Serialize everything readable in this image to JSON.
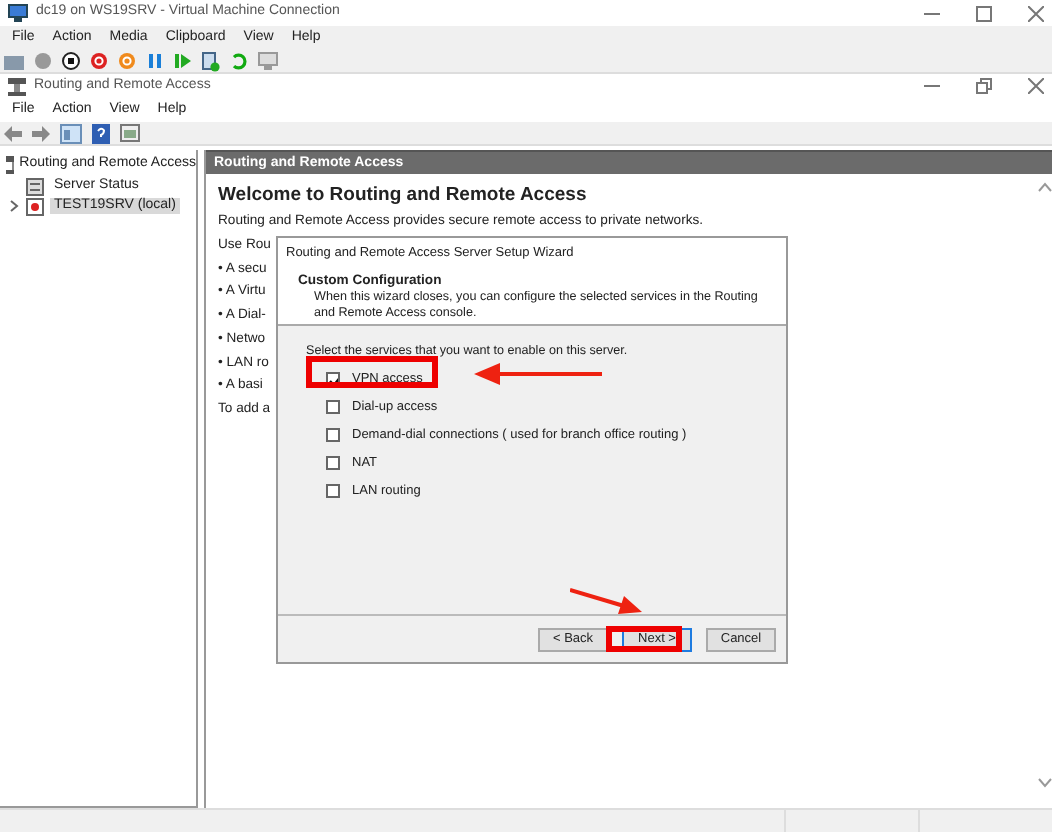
{
  "vm_window": {
    "title": "dc19 on WS19SRV - Virtual Machine Connection",
    "menu": [
      "File",
      "Action",
      "Media",
      "Clipboard",
      "View",
      "Help"
    ]
  },
  "mmc_window": {
    "title": "Routing and Remote Access",
    "menu": [
      "File",
      "Action",
      "View",
      "Help"
    ]
  },
  "tree": [
    {
      "label": "Routing and Remote Access",
      "selected": false,
      "children": [
        {
          "label": "Server Status",
          "selected": false
        },
        {
          "label": "TEST19SRV (local)",
          "selected": true,
          "expanded": false
        }
      ]
    }
  ],
  "pane": {
    "header": "Routing and Remote Access",
    "heading": "Welcome to Routing and Remote Access",
    "intro": "Routing and Remote Access provides secure remote access to private networks.",
    "lines": [
      "Use Rou",
      "• A secu",
      "• A Virtu",
      "• A Dial-",
      "• Netwo",
      "• LAN ro",
      "• A basi",
      "To add a"
    ]
  },
  "wizard": {
    "title": "Routing and Remote Access Server Setup Wizard",
    "heading": "Custom Configuration",
    "description": "When this wizard closes, you can configure the selected services in the Routing and Remote Access console.",
    "prompt": "Select the services that you want to enable on this server.",
    "services": [
      {
        "label": "VPN access",
        "checked": true
      },
      {
        "label": "Dial-up access",
        "checked": false
      },
      {
        "label": "Demand-dial connections ( used for branch office routing )",
        "checked": false
      },
      {
        "label": "NAT",
        "checked": false
      },
      {
        "label": "LAN routing",
        "checked": false
      }
    ],
    "buttons": [
      {
        "label": "< Back",
        "default": false
      },
      {
        "label": "Next >",
        "default": true
      },
      {
        "label": "Cancel",
        "default": false
      }
    ]
  }
}
